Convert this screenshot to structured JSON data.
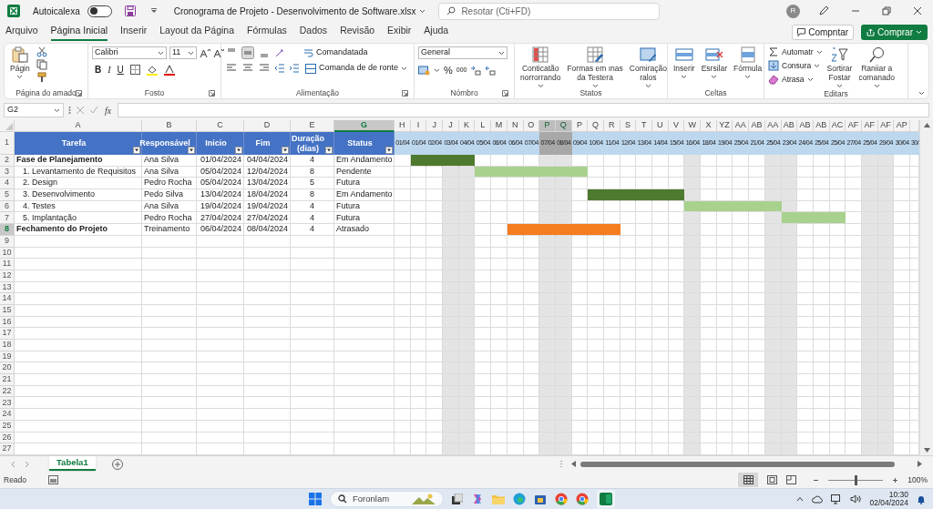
{
  "title_bar": {
    "autosave_label": "Autoicalexa",
    "autosave_on": false,
    "file_name": "Cronograma de Projeto - Desenvolvimento de Software.xlsx",
    "search_placeholder": "Resotar (Cti+FD)",
    "avatar": "R"
  },
  "menu_tabs": [
    {
      "label": "Arquivo",
      "selected": false
    },
    {
      "label": "Página Inicial",
      "selected": true
    },
    {
      "label": "Inserir",
      "selected": false
    },
    {
      "label": "Layout da Página",
      "selected": false
    },
    {
      "label": "Fórmulas",
      "selected": false
    },
    {
      "label": "Dados",
      "selected": false
    },
    {
      "label": "Revisão",
      "selected": false
    },
    {
      "label": "Exibir",
      "selected": false
    },
    {
      "label": "Ajuda",
      "selected": false
    }
  ],
  "share": {
    "comment": "Compntar",
    "share": "Comprar"
  },
  "ribbon": {
    "clipboard": {
      "paste": "Págin",
      "label": "Página do amado"
    },
    "font": {
      "name": "Calibri",
      "size": "11",
      "bold": "B",
      "italic": "I",
      "underline": "U",
      "label": "Fosto"
    },
    "alignment": {
      "wrap": "Comandatada",
      "merge": "Comanda de de ronte",
      "middle_selected": true,
      "label": "Alimentação"
    },
    "number": {
      "format": "General",
      "percent": "%",
      "thousands": "000",
      "label": "Nómbro"
    },
    "styles": {
      "buttons": [
        "Conticatão\nnorrorrando",
        "Formas em ınas\nda Testera",
        "Comiração\nralos"
      ],
      "label": "Statos"
    },
    "cells": {
      "buttons": [
        "Inserir",
        "Esrsilar",
        "Fórmula"
      ],
      "label": "Celtas"
    },
    "editing": {
      "small": [
        "Automatr",
        "Consura",
        "Atrasa"
      ],
      "buttons": [
        "Sortirar\nFostar",
        "Raniiar a\ncomanado"
      ],
      "label": "Editars"
    }
  },
  "formula_bar": {
    "name_box": "G2",
    "function_label": "fx"
  },
  "table": {
    "columns": [
      {
        "letter": "A",
        "title": "Tarefa",
        "selected": false
      },
      {
        "letter": "B",
        "title": "Responsável",
        "selected": false
      },
      {
        "letter": "C",
        "title": "Inicio",
        "selected": false
      },
      {
        "letter": "D",
        "title": "Fim",
        "selected": false
      },
      {
        "letter": "E",
        "title": "Duração\n(dias)",
        "selected": false
      },
      {
        "letter": "G",
        "title": "Status",
        "selected": true
      }
    ],
    "row_headers": [
      {
        "label": "1",
        "selected": false
      },
      {
        "label": "2",
        "selected": false
      },
      {
        "label": "3",
        "selected": false
      },
      {
        "label": "4",
        "selected": false
      },
      {
        "label": "5",
        "selected": false
      },
      {
        "label": "6",
        "selected": false
      },
      {
        "label": "7",
        "selected": false
      },
      {
        "label": "8",
        "selected": true
      },
      {
        "label": "9",
        "selected": false
      },
      {
        "label": "10",
        "selected": false
      },
      {
        "label": "11",
        "selected": false
      },
      {
        "label": "12",
        "selected": false
      },
      {
        "label": "13",
        "selected": false
      },
      {
        "label": "14",
        "selected": false
      },
      {
        "label": "15",
        "selected": false
      },
      {
        "label": "16",
        "selected": false
      },
      {
        "label": "17",
        "selected": false
      },
      {
        "label": "18",
        "selected": false
      },
      {
        "label": "19",
        "selected": false
      },
      {
        "label": "20",
        "selected": false
      },
      {
        "label": "21",
        "selected": false
      },
      {
        "label": "22",
        "selected": false
      },
      {
        "label": "23",
        "selected": false
      },
      {
        "label": "24",
        "selected": false
      },
      {
        "label": "25",
        "selected": false
      },
      {
        "label": "26",
        "selected": false
      },
      {
        "label": "27",
        "selected": false
      }
    ],
    "tasks": [
      {
        "task": "Fase de Planejamento",
        "owner": "Ana Silva",
        "start": "01/04/2024",
        "end": "04/04/2024",
        "duration": "4",
        "status": "Em Andamento",
        "bar": {
          "color": "#4e7a2f",
          "cells": [
            false,
            true,
            true,
            true,
            true,
            false,
            false,
            false,
            false,
            false,
            false,
            false,
            false,
            false,
            false,
            false,
            false,
            false,
            false,
            false,
            false,
            false,
            false,
            false,
            false,
            false,
            false,
            false,
            false,
            false,
            false,
            false,
            false
          ]
        },
        "children": [
          {
            "task": "1. Levantamento de Requisitos",
            "owner": "Ana Silva",
            "start": "05/04/2024",
            "end": "12/04/2024",
            "duration": "8",
            "status": "Pendente",
            "bar": {
              "color": "#a9d18e",
              "cells": [
                false,
                false,
                false,
                false,
                false,
                true,
                true,
                true,
                true,
                true,
                true,
                true,
                false,
                false,
                false,
                false,
                false,
                false,
                false,
                false,
                false,
                false,
                false,
                false,
                false,
                false,
                false,
                false,
                false,
                false,
                false,
                false,
                false
              ]
            }
          },
          {
            "task": "2. Design",
            "owner": "Pedro Rocha",
            "start": "05/04/2024",
            "end": "13/04/2024",
            "duration": "5",
            "status": "Futura"
          },
          {
            "task": "3. Desenvolvimento",
            "owner": "Pedo Silva",
            "start": "13/04/2024",
            "end": "18/04/2024",
            "duration": "8",
            "status": "Em Andamento",
            "bar": {
              "color": "#4e7a2f",
              "cells": [
                false,
                false,
                false,
                false,
                false,
                false,
                false,
                false,
                false,
                false,
                false,
                false,
                true,
                true,
                true,
                true,
                true,
                true,
                false,
                false,
                false,
                false,
                false,
                false,
                false,
                false,
                false,
                false,
                false,
                false,
                false,
                false,
                false
              ]
            }
          },
          {
            "task": "4. Testes",
            "owner": "Ana Silva",
            "start": "19/04/2024",
            "end": "19/04/2024",
            "duration": "4",
            "status": "Futura",
            "bar": {
              "color": "#a9d18e",
              "cells": [
                false,
                false,
                false,
                false,
                false,
                false,
                false,
                false,
                false,
                false,
                false,
                false,
                false,
                false,
                false,
                false,
                false,
                false,
                true,
                true,
                true,
                true,
                true,
                true,
                false,
                false,
                false,
                false,
                false,
                false,
                false,
                false,
                false
              ]
            }
          },
          {
            "task": "5. Implantação",
            "owner": "Pedro Rocha",
            "start": "27/04/2024",
            "end": "27/04/2024",
            "duration": "4",
            "status": "Futura",
            "bar": {
              "color": "#a9d18e",
              "cells": [
                false,
                false,
                false,
                false,
                false,
                false,
                false,
                false,
                false,
                false,
                false,
                false,
                false,
                false,
                false,
                false,
                false,
                false,
                false,
                false,
                false,
                false,
                false,
                false,
                true,
                true,
                true,
                true,
                false,
                false,
                false,
                false,
                false
              ]
            }
          }
        ]
      },
      {
        "task": "Fechamento do Projeto",
        "owner": "Treinamento",
        "start": "06/04/2024",
        "end": "08/04/2024",
        "duration": "4",
        "status": "Atrasado",
        "bar": {
          "color": "#f57c1f",
          "cells": [
            false,
            false,
            false,
            false,
            false,
            false,
            false,
            true,
            true,
            true,
            true,
            true,
            true,
            true,
            false,
            false,
            false,
            false,
            false,
            false,
            false,
            false,
            false,
            false,
            false,
            false,
            false,
            false,
            false,
            false,
            false,
            false,
            false
          ]
        }
      }
    ]
  },
  "timeline": [
    {
      "letter": "H",
      "date": "01/04",
      "shaded": false,
      "selected": false
    },
    {
      "letter": "I",
      "date": "01/04",
      "shaded": false,
      "selected": false
    },
    {
      "letter": "J",
      "date": "02/04",
      "shaded": false,
      "selected": false
    },
    {
      "letter": "J",
      "date": "03/04",
      "shaded": true,
      "selected": false
    },
    {
      "letter": "K",
      "date": "04/04",
      "shaded": true,
      "selected": false
    },
    {
      "letter": "L",
      "date": "05/04",
      "shaded": false,
      "selected": false
    },
    {
      "letter": "M",
      "date": "08/04",
      "shaded": false,
      "selected": false
    },
    {
      "letter": "N",
      "date": "06/04",
      "shaded": false,
      "selected": false
    },
    {
      "letter": "O",
      "date": "07/04",
      "shaded": false,
      "selected": false
    },
    {
      "letter": "P",
      "date": "07/04",
      "shaded": true,
      "selected": true
    },
    {
      "letter": "Q",
      "date": "08/04",
      "shaded": true,
      "selected": true
    },
    {
      "letter": "P",
      "date": "09/04",
      "shaded": false,
      "selected": false
    },
    {
      "letter": "Q",
      "date": "10/04",
      "shaded": false,
      "selected": false
    },
    {
      "letter": "R",
      "date": "11/04",
      "shaded": false,
      "selected": false
    },
    {
      "letter": "S",
      "date": "12/04",
      "shaded": false,
      "selected": false
    },
    {
      "letter": "T",
      "date": "13/04",
      "shaded": false,
      "selected": false
    },
    {
      "letter": "U",
      "date": "14/04",
      "shaded": false,
      "selected": false
    },
    {
      "letter": "V",
      "date": "15/04",
      "shaded": false,
      "selected": false
    },
    {
      "letter": "W",
      "date": "16/04",
      "shaded": true,
      "selected": false
    },
    {
      "letter": "X",
      "date": "18/04",
      "shaded": false,
      "selected": false
    },
    {
      "letter": "YZ",
      "date": "19/04",
      "shaded": false,
      "selected": false
    },
    {
      "letter": "AA",
      "date": "25/04",
      "shaded": false,
      "selected": false
    },
    {
      "letter": "AB",
      "date": "21/04",
      "shaded": false,
      "selected": false
    },
    {
      "letter": "AA",
      "date": "25/04",
      "shaded": true,
      "selected": false
    },
    {
      "letter": "AB",
      "date": "23/04",
      "shaded": true,
      "selected": false
    },
    {
      "letter": "AB",
      "date": "24/04",
      "shaded": false,
      "selected": false
    },
    {
      "letter": "AB",
      "date": "25/04",
      "shaded": false,
      "selected": false
    },
    {
      "letter": "AC",
      "date": "25/04",
      "shaded": false,
      "selected": false
    },
    {
      "letter": "AF",
      "date": "27/04",
      "shaded": false,
      "selected": false
    },
    {
      "letter": "AF",
      "date": "25/04",
      "shaded": true,
      "selected": false
    },
    {
      "letter": "AF",
      "date": "29/04",
      "shaded": true,
      "selected": false
    },
    {
      "letter": "AP",
      "date": "30/04",
      "shaded": false,
      "selected": false
    },
    {
      "date": "30/",
      "shaded": false,
      "selected": false
    }
  ],
  "sheet_tabs": [
    {
      "label": "Tabela1",
      "selected": true
    }
  ],
  "status_bar": {
    "ready": "Reado",
    "zoom": "100%",
    "zoom_level": {
      "level": 0.5
    }
  },
  "taskbar": {
    "search": "Foronlam",
    "time": "10:30",
    "date": "02/04/2024"
  }
}
